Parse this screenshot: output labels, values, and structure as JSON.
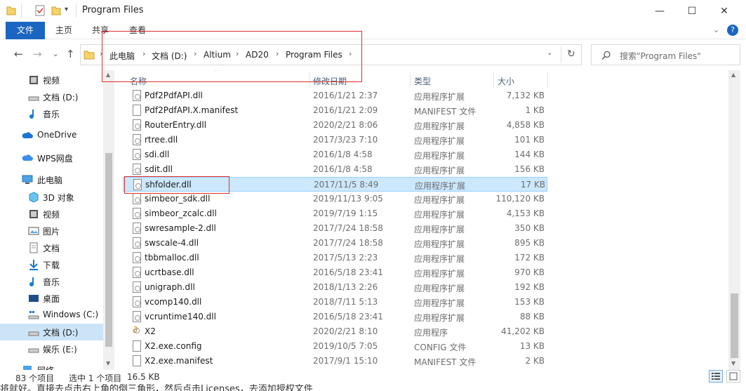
{
  "window": {
    "title": "Program Files",
    "minimize": "—",
    "maximize": "☐",
    "close": "✕"
  },
  "ribbon": {
    "tabs": [
      "文件",
      "主页",
      "共享",
      "查看"
    ],
    "collapse": "⌄",
    "help": "?"
  },
  "breadcrumb": [
    "此电脑",
    "文档 (D:)",
    "Altium",
    "AD20",
    "Program Files"
  ],
  "search": {
    "placeholder": "搜索\"Program Files\""
  },
  "sidebar": {
    "items": [
      {
        "label": "视频",
        "icon": "video-icon"
      },
      {
        "label": "文档 (D:)",
        "icon": "drive-icon"
      },
      {
        "label": "音乐",
        "icon": "music-icon"
      },
      {
        "label": "OneDrive",
        "icon": "cloud-icon"
      },
      {
        "label": "WPS网盘",
        "icon": "wps-cloud-icon"
      },
      {
        "label": "此电脑",
        "icon": "computer-icon"
      },
      {
        "label": "3D 对象",
        "icon": "3d-objects-icon"
      },
      {
        "label": "视频",
        "icon": "video-icon"
      },
      {
        "label": "图片",
        "icon": "pictures-icon"
      },
      {
        "label": "文档",
        "icon": "documents-icon"
      },
      {
        "label": "下载",
        "icon": "download-icon"
      },
      {
        "label": "音乐",
        "icon": "music-icon"
      },
      {
        "label": "桌面",
        "icon": "desktop-icon"
      },
      {
        "label": "Windows (C:)",
        "icon": "windows-drive-icon"
      },
      {
        "label": "文档 (D:)",
        "icon": "drive-icon"
      },
      {
        "label": "娱乐 (E:)",
        "icon": "drive-icon"
      },
      {
        "label": "网络",
        "icon": "network-icon"
      }
    ]
  },
  "columns": {
    "name": "名称",
    "date": "修改日期",
    "type": "类型",
    "size": "大小"
  },
  "files": [
    {
      "name": "Pdf2PdfAPI.dll",
      "date": "2016/1/21 2:37",
      "type": "应用程序扩展",
      "size": "7,132 KB"
    },
    {
      "name": "Pdf2PdfAPI.X.manifest",
      "date": "2016/1/21 2:09",
      "type": "MANIFEST 文件",
      "size": "1 KB"
    },
    {
      "name": "RouterEntry.dll",
      "date": "2020/2/21 8:06",
      "type": "应用程序扩展",
      "size": "4,858 KB"
    },
    {
      "name": "rtree.dll",
      "date": "2017/3/23 7:10",
      "type": "应用程序扩展",
      "size": "101 KB"
    },
    {
      "name": "sdi.dll",
      "date": "2016/1/8 4:58",
      "type": "应用程序扩展",
      "size": "144 KB"
    },
    {
      "name": "sdit.dll",
      "date": "2016/1/8 4:58",
      "type": "应用程序扩展",
      "size": "156 KB"
    },
    {
      "name": "shfolder.dll",
      "date": "2017/11/5 8:49",
      "type": "应用程序扩展",
      "size": "17 KB"
    },
    {
      "name": "simbeor_sdk.dll",
      "date": "2019/11/13 9:05",
      "type": "应用程序扩展",
      "size": "110,120 KB"
    },
    {
      "name": "simbeor_zcalc.dll",
      "date": "2019/7/19 1:15",
      "type": "应用程序扩展",
      "size": "4,153 KB"
    },
    {
      "name": "swresample-2.dll",
      "date": "2017/7/24 18:58",
      "type": "应用程序扩展",
      "size": "350 KB"
    },
    {
      "name": "swscale-4.dll",
      "date": "2017/7/24 18:58",
      "type": "应用程序扩展",
      "size": "895 KB"
    },
    {
      "name": "tbbmalloc.dll",
      "date": "2017/5/13 2:23",
      "type": "应用程序扩展",
      "size": "172 KB"
    },
    {
      "name": "ucrtbase.dll",
      "date": "2016/5/18 23:41",
      "type": "应用程序扩展",
      "size": "970 KB"
    },
    {
      "name": "unigraph.dll",
      "date": "2018/1/13 2:26",
      "type": "应用程序扩展",
      "size": "192 KB"
    },
    {
      "name": "vcomp140.dll",
      "date": "2018/7/11 5:13",
      "type": "应用程序扩展",
      "size": "153 KB"
    },
    {
      "name": "vcruntime140.dll",
      "date": "2016/5/18 23:41",
      "type": "应用程序扩展",
      "size": "88 KB"
    },
    {
      "name": "X2",
      "date": "2020/2/21 8:10",
      "type": "应用程序",
      "size": "41,202 KB"
    },
    {
      "name": "X2.exe.config",
      "date": "2019/10/5 7:05",
      "type": "CONFIG 文件",
      "size": "13 KB"
    },
    {
      "name": "X2.exe.manifest",
      "date": "2017/9/1 15:10",
      "type": "MANIFEST 文件",
      "size": "2 KB"
    }
  ],
  "status": {
    "count": "83 个项目",
    "selected": "选中 1 个项目",
    "size": "16.5 KB"
  },
  "caption": "将就好。直接去点击右上角的倒三角形，然后点击Licenses，去添加授权文件"
}
